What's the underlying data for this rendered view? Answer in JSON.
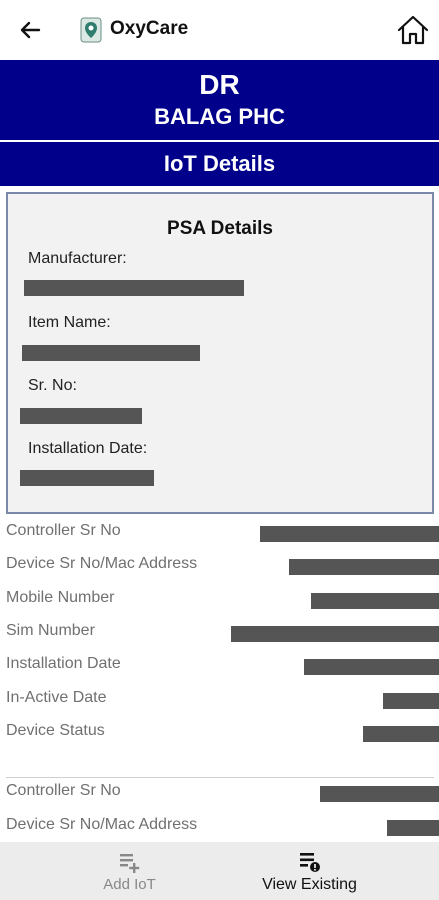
{
  "app": {
    "title": "OxyCare"
  },
  "header": {
    "line1": "DR",
    "line2": "BALAG PHC",
    "section": "IoT Details"
  },
  "psa": {
    "title": "PSA Details",
    "fields": [
      {
        "label": "Manufacturer:"
      },
      {
        "label": "Item Name:"
      },
      {
        "label": "Sr. No:"
      },
      {
        "label": "Installation Date:"
      }
    ]
  },
  "device1": {
    "rows": [
      {
        "label": "Controller Sr No"
      },
      {
        "label": "Device Sr No/Mac Address"
      },
      {
        "label": "Mobile Number"
      },
      {
        "label": "Sim Number"
      },
      {
        "label": "Installation Date"
      },
      {
        "label": "In-Active Date"
      },
      {
        "label": "Device Status"
      }
    ]
  },
  "device2": {
    "rows": [
      {
        "label": "Controller Sr No"
      },
      {
        "label": "Device Sr No/Mac Address"
      }
    ]
  },
  "nav": {
    "add_label": "Add IoT",
    "view_label": "View Existing"
  },
  "colors": {
    "banner": "#00008b",
    "redaction": "#555555"
  },
  "icons": [
    "back-arrow-icon",
    "oxycare-logo-icon",
    "home-icon",
    "add-list-icon",
    "view-list-icon"
  ]
}
